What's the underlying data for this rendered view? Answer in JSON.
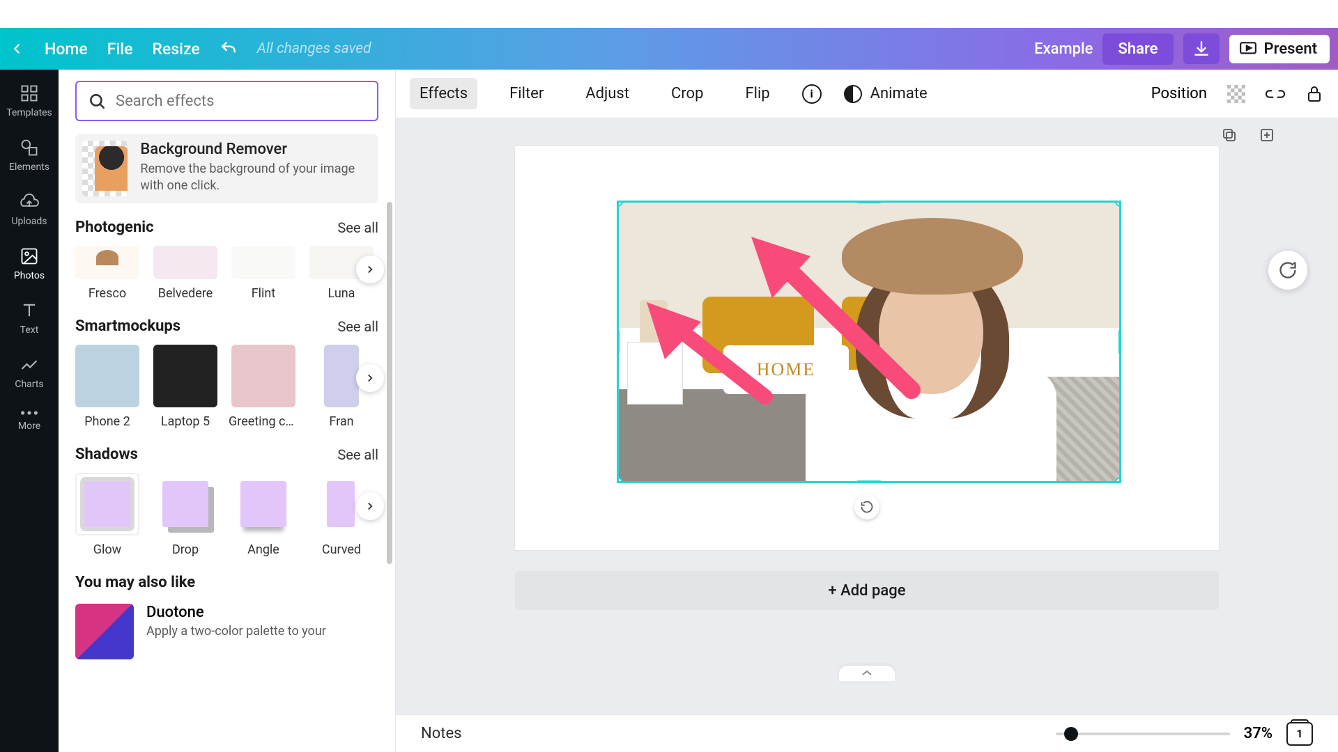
{
  "header": {
    "home": "Home",
    "file": "File",
    "resize": "Resize",
    "saved": "All changes saved",
    "example": "Example",
    "share": "Share",
    "present": "Present"
  },
  "iconbar": {
    "templates": "Templates",
    "elements": "Elements",
    "uploads": "Uploads",
    "photos": "Photos",
    "text": "Text",
    "charts": "Charts",
    "more": "More"
  },
  "panel": {
    "search_placeholder": "Search effects",
    "bg_remover": {
      "title": "Background Remover",
      "desc": "Remove the background of your image with one click."
    },
    "photogenic": {
      "title": "Photogenic",
      "see_all": "See all",
      "items": [
        "Fresco",
        "Belvedere",
        "Flint",
        "Luna"
      ]
    },
    "smartmockups": {
      "title": "Smartmockups",
      "see_all": "See all",
      "items": [
        "Phone 2",
        "Laptop 5",
        "Greeting car...",
        "Fran"
      ]
    },
    "shadows": {
      "title": "Shadows",
      "see_all": "See all",
      "items": [
        "Glow",
        "Drop",
        "Angle",
        "Curved"
      ]
    },
    "you_may": {
      "title": "You may also like",
      "duotone": {
        "title": "Duotone",
        "desc": "Apply a two-color palette to your"
      }
    }
  },
  "toolbar": {
    "effects": "Effects",
    "filter": "Filter",
    "adjust": "Adjust",
    "crop": "Crop",
    "flip": "Flip",
    "animate": "Animate",
    "position": "Position"
  },
  "canvas": {
    "home_pillow": "HOME",
    "add_page": "+ Add page"
  },
  "bottom": {
    "notes": "Notes",
    "zoom": "37%",
    "page_count": "1"
  }
}
